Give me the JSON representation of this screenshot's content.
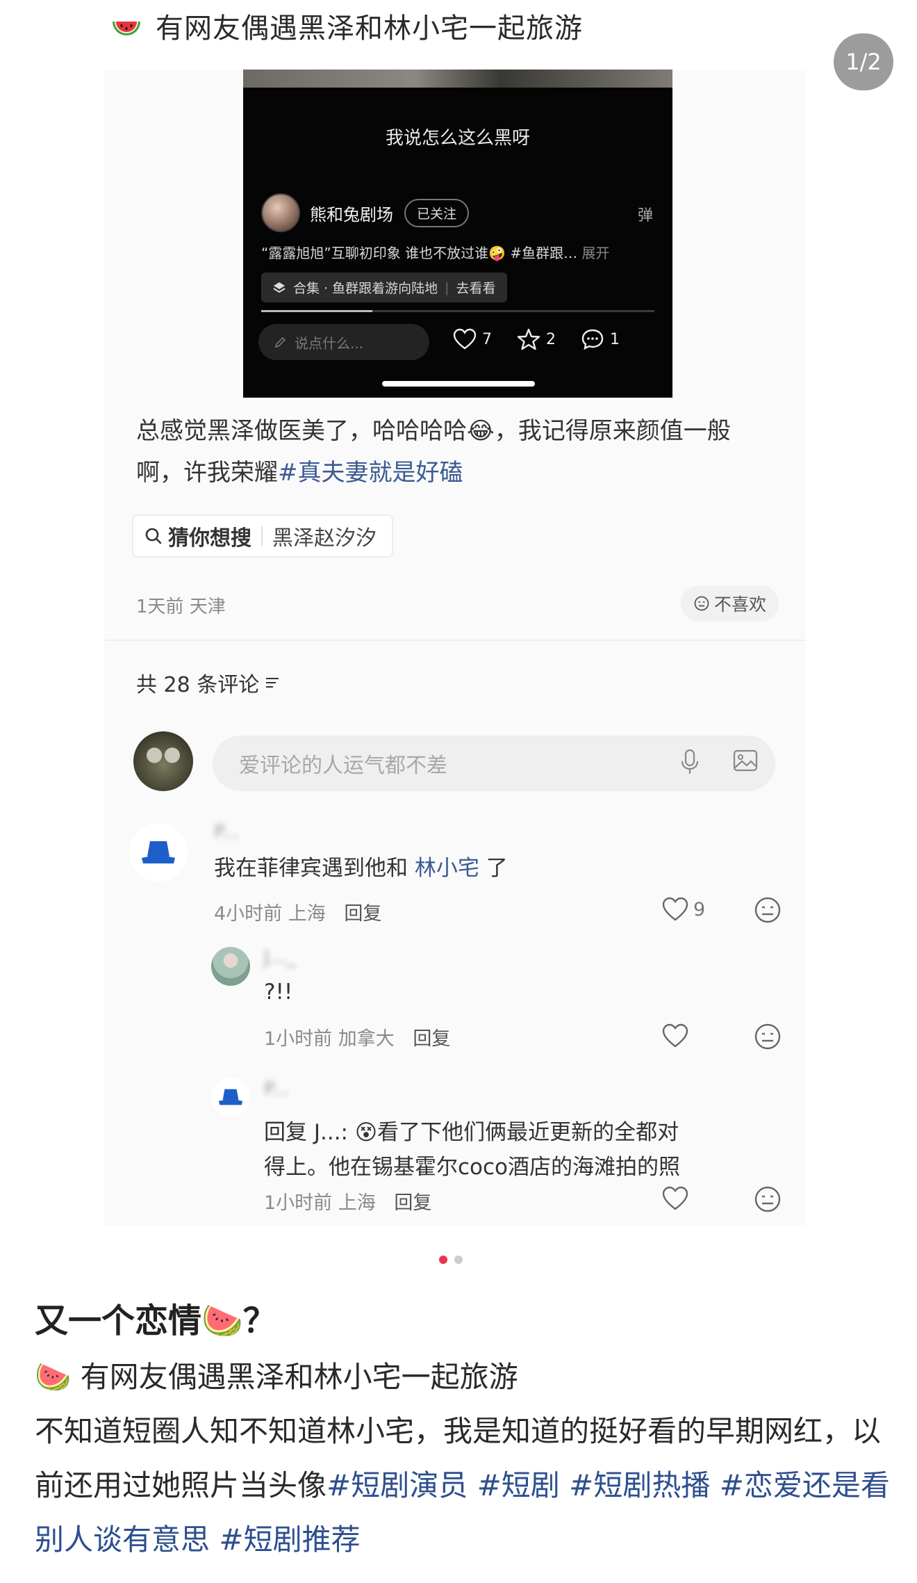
{
  "top_caption": {
    "emoji": "watermelon-emoji",
    "text": "有网友偶遇黑泽和林小宅一起旅游"
  },
  "page_counter": "1/2",
  "video": {
    "subtitle": "我说怎么这么黑呀",
    "author": "熊和兔剧场",
    "follow_label": "已关注",
    "danmu_label": "弹",
    "description": "“露露旭旭”互聊初印象 谁也不放过谁🤪 #鱼群跟…",
    "expand_label": "展开",
    "collection": {
      "name": "合集 · 鱼群跟着游向陆地",
      "action": "去看看"
    },
    "comment_placeholder": "说点什么...",
    "likes": "7",
    "favorites": "2",
    "comments": "1"
  },
  "post": {
    "text_before_tag": "总感觉黑泽做医美了，哈哈哈哈😂，我记得原来颜值一般啊，许我荣耀",
    "hashtag": "#真夫妻就是好磕"
  },
  "guess_search": {
    "title": "猜你想搜",
    "term": "黑泽赵汐汐"
  },
  "meta": {
    "time_location": "1天前 天津",
    "dislike_label": "不喜欢"
  },
  "comments_header": "共 28 条评论",
  "comment_input_placeholder": "爱评论的人运气都不差",
  "comments": [
    {
      "name": "P...",
      "text_before": "我在菲律宾遇到他和 ",
      "mention": "林小宅",
      "text_after": " 了",
      "time": "4小时前",
      "location": "上海",
      "reply_label": "回复",
      "likes": "9"
    },
    {
      "name": "J..._",
      "text": "?!!",
      "time": "1小时前",
      "location": "加拿大",
      "reply_label": "回复",
      "likes": ""
    },
    {
      "name": "P...",
      "text_line1": "回复 J...: 😵看了下他们俩最近更新的全都对",
      "text_line2": "得上。他在锡基霍尔coco酒店的海滩拍的照",
      "time": "1小时前",
      "location": "上海",
      "reply_label": "回复",
      "likes": ""
    }
  ],
  "carousel": {
    "active_index": 1,
    "total": 2
  },
  "post_title": "又一个恋情🍉？",
  "post_body": {
    "line1": "🍉 有网友偶遇黑泽和林小宅一起旅游",
    "text": "不知道短圈人知不知道林小宅，我是知道的挺好看的早期网红，以前还用过她照片当头像",
    "hashtags": [
      "#短剧演员",
      "#短剧",
      "#短剧热播",
      "#恋爱还是看别人谈有意思",
      "#短剧推荐"
    ]
  },
  "colors": {
    "accent_dot": "#e8344a",
    "hashtag": "#2d4f8f",
    "video_bg": "#050505"
  }
}
